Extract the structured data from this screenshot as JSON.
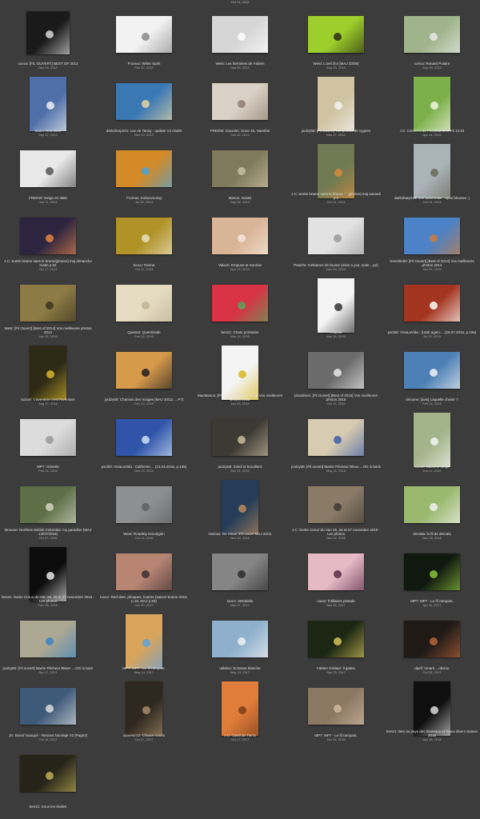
{
  "header_date": "Oct 13, 2012",
  "items": [
    {
      "title": "conca: [FIL OUVERT] BEST OF 2012",
      "date": "Dec 09, 2012",
      "shape": "sq",
      "bg": "#1a1a1a",
      "fg": "#d9d9d9"
    },
    {
      "title": "Fromus: White Spirit",
      "date": "Feb 12, 2012",
      "shape": "land",
      "bg": "#f2f2f2",
      "fg": "#8a8a8a"
    },
    {
      "title": "West: Les hermines de Fabien",
      "date": "Mar 05, 2013",
      "shape": "land",
      "bg": "#d6d6d6",
      "fg": "#ffffff"
    },
    {
      "title": "West: L'oeil d'or [MAJ 23/06]",
      "date": "Aug 25, 2013",
      "shape": "land",
      "bg": "#9ccf2b",
      "fg": "#2b2b12"
    },
    {
      "title": "conca: Renard Polaire",
      "date": "Sep 03, 2013",
      "shape": "land",
      "bg": "#9fb48a",
      "fg": "#e8e8e8"
    },
    {
      "title": "touco: Red Deer",
      "date": "Sep 17, 2013",
      "shape": "port",
      "bg": "#4e6fa8",
      "fg": "#f0f0f0"
    },
    {
      "title": "darksharp231: Lac de Tanay - update V2 chalet",
      "date": "Nov 13, 2013",
      "shape": "land",
      "bg": "#3a78b4",
      "fg": "#e9d6a4"
    },
    {
      "title": "FREDW: Sossvlei, Dune 45, Namibie",
      "date": "Jan 02, 2014",
      "shape": "land",
      "bg": "#d9d1c6",
      "fg": "#8f7f6e"
    },
    {
      "title": "joulzy68: [Fil Ouvert] Vos photos de cygnes",
      "date": "Mar 17, 2014",
      "shape": "port",
      "bg": "#cfc3a2",
      "fg": "#f4f4f4"
    },
    {
      "title": "J.C: Cerisiers du Frickthal MAJ P2 14.04",
      "date": "Apr 14, 2014",
      "shape": "port",
      "bg": "#7bb04a",
      "fg": "#f5f5e8"
    },
    {
      "title": "FREDW: Neige en Italie",
      "date": "Jun 11, 2014",
      "shape": "land",
      "bg": "#e9e9e9",
      "fg": "#555555"
    },
    {
      "title": "Fromus: Kubusvoning",
      "date": "Jul 26, 2014",
      "shape": "land",
      "bg": "#d48a27",
      "fg": "#4aa3d8"
    },
    {
      "title": "Manus: Snake",
      "date": "Sep 02, 2014",
      "shape": "land",
      "bg": "#7f7a5c",
      "fg": "#c9c1a2"
    },
    {
      "title": "J.C: Sortie brame sans le brame ¨¨¨ [photos] maj samedi p.4",
      "date": "Oct 14, 2014",
      "shape": "port",
      "bg": "#6f7a52",
      "fg": "#d88b3a"
    },
    {
      "title": "darksharp231: vue automnale - ajout blousse :)",
      "date": "Oct 15, 2014",
      "shape": "port",
      "bg": "#aab3b8",
      "fg": "#6b6a58"
    },
    {
      "title": "J.C: Sortie brame sans le brame[photos] maj dimanche matin p.52",
      "date": "Oct 17, 2014",
      "shape": "land",
      "bg": "#2d2540",
      "fg": "#e58447"
    },
    {
      "title": "touco: Renne",
      "date": "Oct 22, 2014",
      "shape": "land",
      "bg": "#b09226",
      "fg": "#e8e2c4"
    },
    {
      "title": "Valach: Empuse at Sunrise",
      "date": "Nov 22, 2014",
      "shape": "land",
      "bg": "#d9b597",
      "fg": "#f5e8dc"
    },
    {
      "title": "Peache: Ambiance de brume (mise a jour, suite....p2)",
      "date": "Dec 09, 2014",
      "shape": "land",
      "bg": "#e2e2e2",
      "fg": "#9a9a9a"
    },
    {
      "title": "Kenshin83: [Fil Ouvert] [Best of 2014] Vos meilleures photos 2014",
      "date": "Jan 03, 2015",
      "shape": "land",
      "bg": "#4b82c8",
      "fg": "#c97d3e"
    },
    {
      "title": "West: [Fil Ouvert] [Best of 2014] Vos meilleures photos 2014",
      "date": "Jan 05, 2015",
      "shape": "land",
      "bg": "#8c7b45",
      "fg": "#3b3420"
    },
    {
      "title": "Quentin: Quentizade",
      "date": "Feb 16, 2015",
      "shape": "land",
      "bg": "#e6dcc3",
      "fg": "#bfb294"
    },
    {
      "title": "ben21: Chant printanier",
      "date": "Mar 16, 2015",
      "shape": "land",
      "bg": "#d93244",
      "fg": "#5da35a"
    },
    {
      "title": "Peache",
      "date": "Mar 18, 2015",
      "shape": "port",
      "bg": "#f4f4f4",
      "fg": "#333333"
    },
    {
      "title": "pschitt: VivaLaVida : (Utah again.....(25.07.2015, p.106)",
      "date": "Jul 25, 2015",
      "shape": "land",
      "bg": "#a3341f",
      "fg": "#ffffff"
    },
    {
      "title": "luciani: L'aventure c'est l'aventure",
      "date": "Aug 17, 2015",
      "shape": "port",
      "bg": "#2e2a16",
      "fg": "#d8b62b"
    },
    {
      "title": "joulzy68: Chamois des Vosges [MAJ 10/12.....P7]",
      "date": "Dec 10, 2015",
      "shape": "land",
      "bg": "#d69a4b",
      "fg": "#1e1e1e"
    },
    {
      "title": "MacManus: [Fil Ouvert] [Best of 2015] Vos meilleures photos 2015",
      "date": "Jan 03, 2016",
      "shape": "port",
      "bg": "#f4f4f4",
      "fg": "#d9b51c"
    },
    {
      "title": "photofenn: [Fil Ouvert] [Best of 2015] Vos meilleures photos 2015",
      "date": "Jan 12, 2016",
      "shape": "land",
      "bg": "#6b6b6b",
      "fg": "#e9e9e9"
    },
    {
      "title": "timoune: [avis] Laquelle choisir ?",
      "date": "Feb 14, 2016",
      "shape": "land",
      "bg": "#4d80b6",
      "fg": "#f2f2f2"
    },
    {
      "title": "MP7: Grisette",
      "date": "Feb 24, 2016",
      "shape": "land",
      "bg": "#dcdcdc",
      "fg": "#999999"
    },
    {
      "title": "pschitt: VivaLaVida : Californie.... (13.03.2016, p.135)",
      "date": "Mar 13, 2016",
      "shape": "land",
      "bg": "#2f54a8",
      "fg": "#cfe1f5"
    },
    {
      "title": "joulzy68: Soleil et brouillard",
      "date": "Mar 21, 2016",
      "shape": "land",
      "bg": "#3c3a34",
      "fg": "#c8bd9a"
    },
    {
      "title": "joulzy68: [Fil ouvert] Martin Pêcheur Bleue ...OG is back",
      "date": "May 21, 2016",
      "shape": "land",
      "bg": "#d7cbb1",
      "fg": "#3c5ea4"
    },
    {
      "title": "Lionel: Blanche neige",
      "date": "Jun 21, 2016",
      "shape": "port",
      "bg": "#a4b48a",
      "fg": "#f4f4f4"
    },
    {
      "title": "timoune: Northern British Columbia: my paradise (MAJ 13/07/2016)",
      "date": "Oct 07, 2016",
      "shape": "land",
      "bg": "#5e6f48",
      "fg": "#d3d3c2"
    },
    {
      "title": "West: Roadtrip Norvégien",
      "date": "Oct 12, 2016",
      "shape": "land",
      "bg": "#8e8f91",
      "fg": "#5f6062"
    },
    {
      "title": "marcao: De retour d'Ecosse! MAJ 20/11",
      "date": "Nov 20, 2016",
      "shape": "port",
      "bg": "#263c58",
      "fg": "#b98a5a"
    },
    {
      "title": "J.C: Sortie Creuz-du-Van 25, 26 et 27 novembre 2016 - Les photos",
      "date": "Dec 02, 2016",
      "shape": "land",
      "bg": "#8a7b67",
      "fg": "#3e3a32"
    },
    {
      "title": "demala: le fil de demala",
      "date": "Dec 05, 2016",
      "shape": "land",
      "bg": "#9ab96f",
      "fg": "#f2f2f2"
    },
    {
      "title": "ben21: Sortie Creux-du-Van 25, 26 et 27 novembre 2016 - Les photos",
      "date": "Dec 06, 2016",
      "shape": "port",
      "bg": "#0d0d0d",
      "fg": "#e7e7e7"
    },
    {
      "title": "touco: Red deer, phoques, loutres (saison brame 2016, p.16, MAJ p.83)",
      "date": "Jan 30, 2017",
      "shape": "land",
      "bg": "#b88573",
      "fg": "#3a2f33"
    },
    {
      "title": "touco: 30sdublin",
      "date": "Mar 07, 2017",
      "shape": "land",
      "bg": "#858585",
      "fg": "#2c2c2c"
    },
    {
      "title": "caroe: fritillaires pintade",
      "date": "Mar 26, 2017",
      "shape": "land",
      "bg": "#e5b9c6",
      "fg": "#5a2c44"
    },
    {
      "title": "MP7: MP7 - Le fil rampant.",
      "date": "Apr 26, 2017",
      "shape": "land",
      "bg": "#101810",
      "fg": "#8cc43a"
    },
    {
      "title": "joulzy68: [Fil ouvert] Martin Pêcheur Bleue ....OG is back",
      "date": "Apr 17, 2017",
      "shape": "land",
      "bg": "#ada891",
      "fg": "#3b84c2"
    },
    {
      "title": "MP7: MP7 - Le fil rampant.",
      "date": "May 14, 2017",
      "shape": "port",
      "bg": "#d9a55b",
      "fg": "#5fa0e2"
    },
    {
      "title": "rallalou: Echasse blanche",
      "date": "May 24, 2017",
      "shape": "land",
      "bg": "#8fb0cc",
      "fg": "#f2f2f2"
    },
    {
      "title": "Fabien Grélaer: ll gaites",
      "date": "Sep 29, 2017",
      "shape": "land",
      "bg": "#1b2712",
      "fg": "#d8c35a"
    },
    {
      "title": "dpell: renard ...obscur",
      "date": "Oct 05, 2017",
      "shape": "land",
      "bg": "#1f1a16",
      "fg": "#b8653a"
    },
    {
      "title": "JK: Boeuf musqué - Rennes Norvège V2 [Page2]",
      "date": "Oct 16, 2017",
      "shape": "land",
      "bg": "#3e5a79",
      "fg": "#dedede"
    },
    {
      "title": "sauveur13: Chauve souris",
      "date": "Oct 17, 2017",
      "shape": "port",
      "bg": "#2f2820",
      "fg": "#a98b6a"
    },
    {
      "title": "J.C: Castil de Tierra",
      "date": "Oct 17, 2017",
      "shape": "port",
      "bg": "#e07d3a",
      "fg": "#7a3e1c"
    },
    {
      "title": "MP7: MP7 - Le fil rampant.",
      "date": "Jan 26, 2018",
      "shape": "land",
      "bg": "#8a7863",
      "fg": "#d1b7a0"
    },
    {
      "title": "ben21: Ben au pays des blaireaux et *eaux divers Saison 2018",
      "date": "Apr 15, 2018",
      "shape": "port",
      "bg": "#0f0f0f",
      "fg": "#dcdcdc"
    },
    {
      "title": "ben21: Sous les étoiles",
      "date": "",
      "shape": "land",
      "bg": "#262318",
      "fg": "#bfae58"
    }
  ]
}
